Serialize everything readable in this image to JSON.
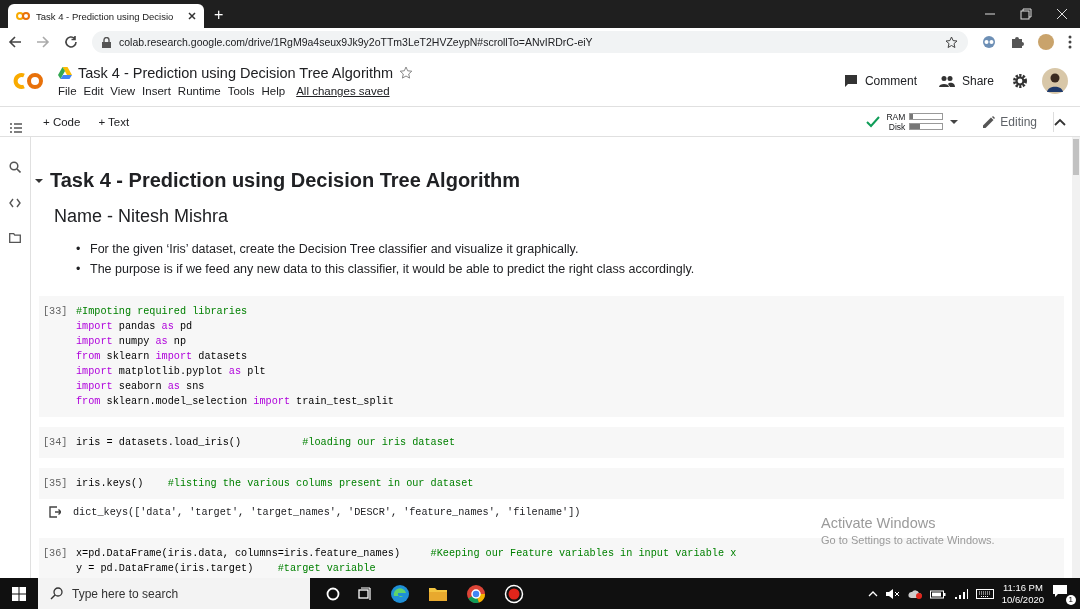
{
  "browser": {
    "tab": {
      "title": "Task 4 - Prediction using Decisio",
      "selected": true
    },
    "new_tab": "+",
    "url": "colab.research.google.com/drive/1RgM9a4seux9Jk9y2oTTm3LeT2HVZeypN#scrollTo=ANvIRDrC-eiY"
  },
  "colab": {
    "title": "Task 4 - Prediction using Decision Tree Algorithm",
    "menu": [
      "File",
      "Edit",
      "View",
      "Insert",
      "Runtime",
      "Tools",
      "Help"
    ],
    "save_status": "All changes saved",
    "actions": [
      {
        "kind": "comment",
        "label": "Comment"
      },
      {
        "kind": "share",
        "label": "Share"
      }
    ]
  },
  "toolbar": {
    "add_buttons": [
      "+ Code",
      "+ Text"
    ],
    "resources": [
      {
        "label": "RAM",
        "level": 0.08
      },
      {
        "label": "Disk",
        "level": 0.3
      }
    ],
    "mode": "Editing"
  },
  "notebook": {
    "heading": "Task 4 - Prediction using Decision Tree Algorithm",
    "expanded": true,
    "subheading": "Name - Nitesh Mishra",
    "bullets": [
      {
        "marker": "•",
        "text": "For the given ‘Iris’ dataset, create the Decision Tree classifier and visualize it graphically."
      },
      {
        "marker": "•",
        "text": "The purpose is if we feed any new data to this classifier, it would be able to predict the right class accordingly."
      }
    ],
    "cells": [
      {
        "number": "[33]",
        "lines": [
          [
            {
              "kind": "comment",
              "text": "#Impoting required libraries"
            }
          ],
          [
            {
              "kind": "keyword",
              "text": "import"
            },
            {
              "kind": "plain",
              "text": " pandas "
            },
            {
              "kind": "keyword",
              "text": "as"
            },
            {
              "kind": "plain",
              "text": " pd"
            }
          ],
          [
            {
              "kind": "keyword",
              "text": "import"
            },
            {
              "kind": "plain",
              "text": " numpy "
            },
            {
              "kind": "keyword",
              "text": "as"
            },
            {
              "kind": "plain",
              "text": " np"
            }
          ],
          [
            {
              "kind": "keyword",
              "text": "from"
            },
            {
              "kind": "plain",
              "text": " sklearn "
            },
            {
              "kind": "keyword",
              "text": "import"
            },
            {
              "kind": "plain",
              "text": " datasets"
            }
          ],
          [
            {
              "kind": "keyword",
              "text": "import"
            },
            {
              "kind": "plain",
              "text": " matplotlib.pyplot "
            },
            {
              "kind": "keyword",
              "text": "as"
            },
            {
              "kind": "plain",
              "text": " plt"
            }
          ],
          [
            {
              "kind": "keyword",
              "text": "import"
            },
            {
              "kind": "plain",
              "text": " seaborn "
            },
            {
              "kind": "keyword",
              "text": "as"
            },
            {
              "kind": "plain",
              "text": " sns"
            }
          ],
          [
            {
              "kind": "keyword",
              "text": "from"
            },
            {
              "kind": "plain",
              "text": " sklearn.model_selection "
            },
            {
              "kind": "keyword",
              "text": "import"
            },
            {
              "kind": "plain",
              "text": " train_test_split"
            }
          ]
        ]
      },
      {
        "number": "[34]",
        "lines": [
          [
            {
              "kind": "plain",
              "text": "iris = datasets.load_iris()          "
            },
            {
              "kind": "comment",
              "text": "#loading our iris dataset"
            }
          ]
        ]
      },
      {
        "number": "[35]",
        "lines": [
          [
            {
              "kind": "plain",
              "text": "iris.keys()    "
            },
            {
              "kind": "comment",
              "text": "#listing the various colums present in our dataset"
            }
          ]
        ],
        "output": "dict_keys(['data', 'target', 'target_names', 'DESCR', 'feature_names', 'filename'])"
      },
      {
        "number": "[36]",
        "lines": [
          [
            {
              "kind": "plain",
              "text": "x=pd.DataFrame(iris.data, columns=iris.feature_names)     "
            },
            {
              "kind": "comment",
              "text": "#Keeping our Feature variables in input variable x"
            }
          ],
          [
            {
              "kind": "plain",
              "text": "y = pd.DataFrame(iris.target)    "
            },
            {
              "kind": "comment",
              "text": "#target variable"
            }
          ]
        ]
      }
    ]
  },
  "activation": {
    "title": "Activate Windows",
    "subtitle": "Go to Settings to activate Windows."
  },
  "taskbar": {
    "search_placeholder": "Type here to search",
    "time": "11:16 PM",
    "date": "10/6/2020",
    "notifications": "1"
  }
}
